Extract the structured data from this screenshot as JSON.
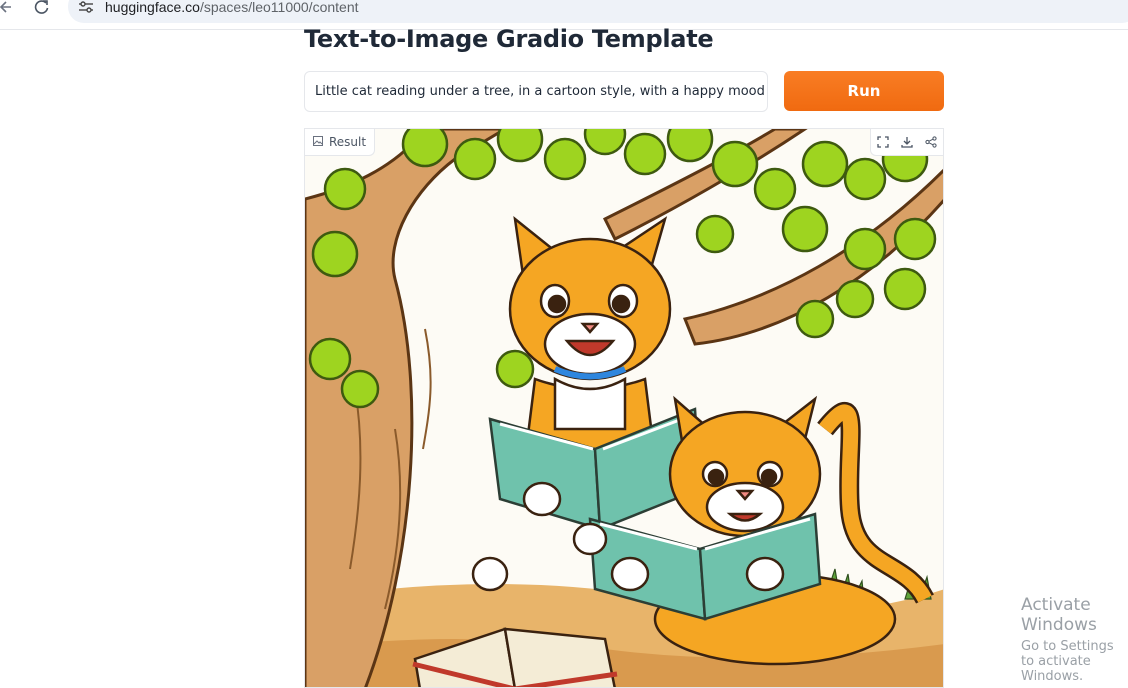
{
  "browser": {
    "url_host": "huggingface.co",
    "url_path": "/spaces/leo11000/content",
    "icons": [
      "back-arrow-icon",
      "reload-icon",
      "site-settings-icon"
    ]
  },
  "app": {
    "title": "Text-to-Image Gradio Template",
    "prompt_value": "Little cat reading under a tree, in a cartoon style, with a happy mood",
    "run_label": "Run",
    "accent_color": "#f97316"
  },
  "result": {
    "label": "Result",
    "toolbar_icons": [
      "fullscreen-icon",
      "download-icon",
      "share-icon"
    ]
  },
  "watermark": {
    "line1": "Activate Windows",
    "line2": "Go to Settings to activate Windows."
  }
}
